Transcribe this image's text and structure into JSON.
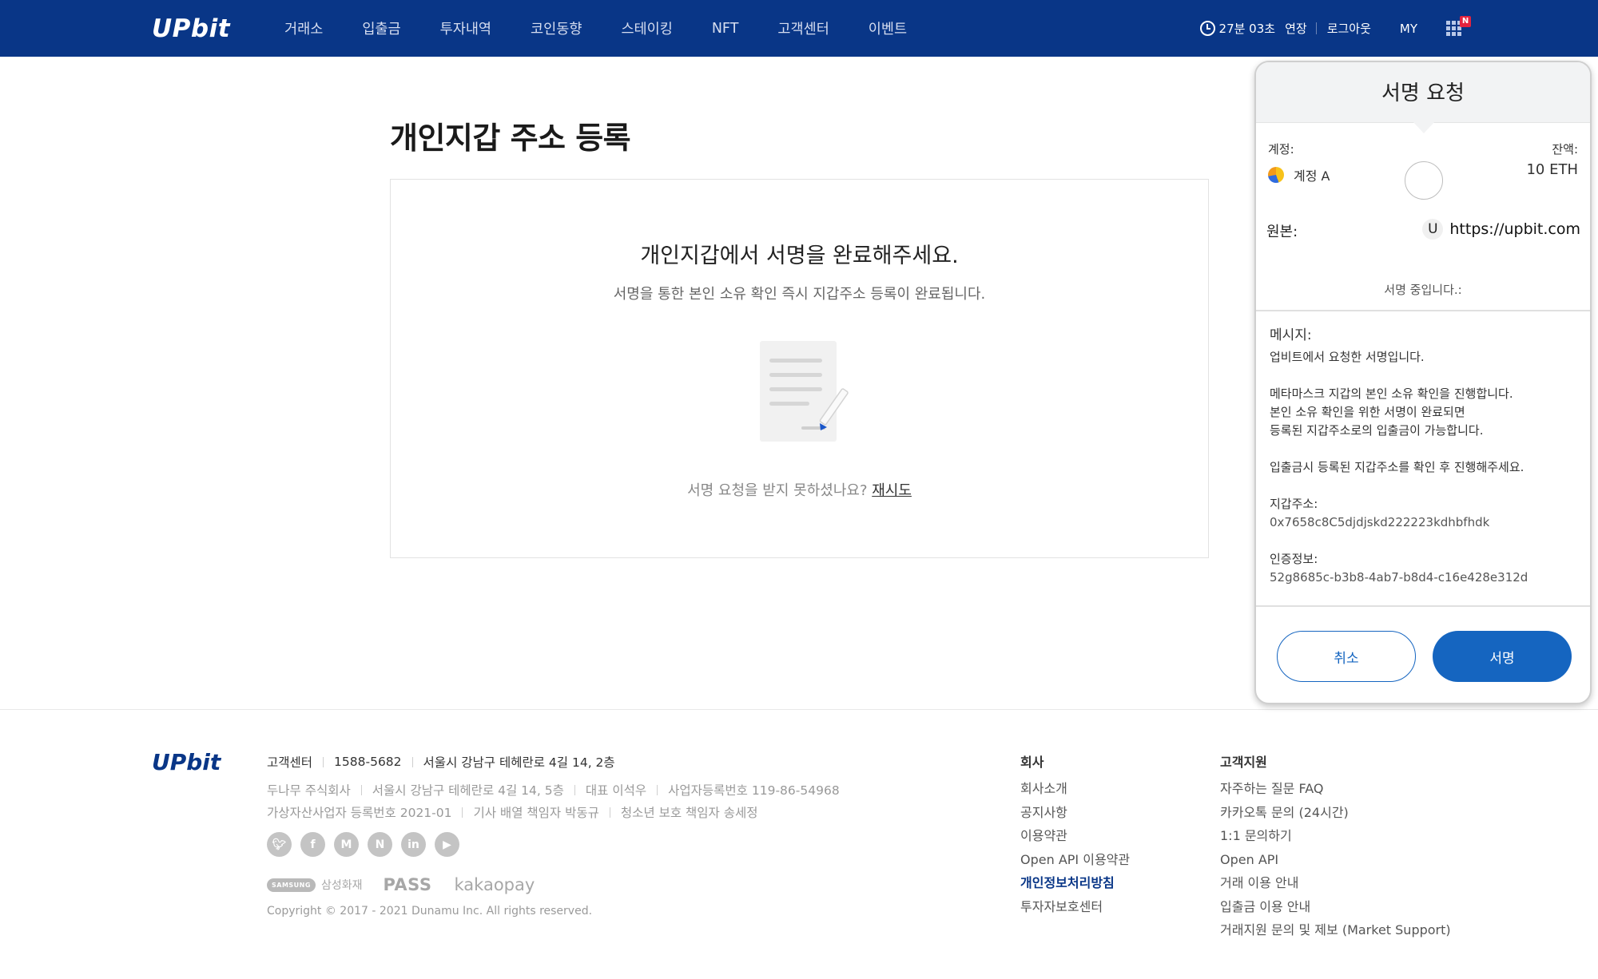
{
  "header": {
    "logo": "UPbit",
    "nav": [
      "거래소",
      "입출금",
      "투자내역",
      "코인동향",
      "스테이킹",
      "NFT",
      "고객센터",
      "이벤트"
    ],
    "timer": "27분 03초",
    "extend": "연장",
    "logout": "로그아웃",
    "my": "MY",
    "badge": "N"
  },
  "main": {
    "title": "개인지갑 주소 등록",
    "box_title": "개인지갑에서 서명을 완료해주세요.",
    "box_subtitle": "서명을 통한 본인 소유 확인 즉시 지갑주소 등록이 완료됩니다.",
    "retry_prompt": "서명 요청을 받지 못하셨나요?",
    "retry_link": "재시도"
  },
  "popup": {
    "title": "서명 요청",
    "account_label": "계정:",
    "account_name": "계정 A",
    "balance_label": "잔액:",
    "balance_value": "10 ETH",
    "origin_label": "원본:",
    "origin_badge": "U",
    "origin_url": "https://upbit.com",
    "signing_status": "서명 중입니다.:",
    "message_label": "메시지:",
    "message_lines": {
      "line1": "업비트에서 요청한 서명입니다.",
      "line2": "메타마스크 지갑의 본인 소유 확인을 진행합니다.",
      "line3": "본인 소유 확인을 위한 서명이 완료되면",
      "line4": "등록된 지갑주소로의 입출금이 가능합니다.",
      "line5": "입출금시 등록된 지갑주소를 확인 후 진행해주세요.",
      "address_label": "지갑주소:",
      "address_value": "0x7658c8C5djdjskd222223kdhbfhdk",
      "auth_label": "인증정보:",
      "auth_value": "52g8685c-b3b8-4ab7-b8d4-c16e428e312d"
    },
    "cancel_label": "취소",
    "sign_label": "서명"
  },
  "footer": {
    "logo": "UPbit",
    "cs_label": "고객센터",
    "cs_phone": "1588-5682",
    "cs_address": "서울시 강남구 테헤란로 4길 14, 2층",
    "company_name": "두나무 주식회사",
    "company_address": "서울시 강남구 테헤란로 4길 14, 5층",
    "ceo": "대표 이석우",
    "biz_no": "사업자등록번호 119-86-54968",
    "vasp_no": "가상자산사업자 등록번호 2021-01",
    "news_editor": "기사 배열 책임자 박동규",
    "youth_officer": "청소년 보호 책임자 송세정",
    "socials": [
      "twitter-icon",
      "facebook-icon",
      "medium-icon",
      "naver-icon",
      "linkedin-icon",
      "youtube-icon"
    ],
    "partner_samsung": "SAMSUNG",
    "partner_samsung_text": "삼성화재",
    "partner_pass": "PASS",
    "partner_kakaopay": "kakaopay",
    "copyright": "Copyright © 2017 - 2021 Dunamu Inc. All rights reserved.",
    "company_col": {
      "title": "회사",
      "links": [
        "회사소개",
        "공지사항",
        "이용약관",
        "Open API 이용약관",
        "개인정보처리방침",
        "투자자보호센터"
      ]
    },
    "support_col": {
      "title": "고객지원",
      "links": [
        "자주하는 질문 FAQ",
        "카카오톡 문의 (24시간)",
        "1:1 문의하기",
        "Open API",
        "거래 이용 안내",
        "입출금 이용 안내",
        "거래지원 문의 및 제보 (Market Support)"
      ]
    }
  }
}
